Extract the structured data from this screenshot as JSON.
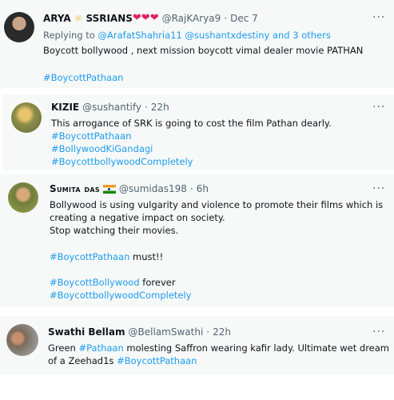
{
  "tweets": [
    {
      "name": "ARYA",
      "name_suffix": "SSRIANS",
      "handle": "@RajKArya9",
      "time": "Dec 7",
      "reply_prefix": "Replying to",
      "reply_to": "@ArafatShahria11 @sushantxdestiny and 3 others",
      "text1": "Boycott bollywood , next mission boycott vimal dealer movie PATHAN",
      "hashtag1": "#BoycottPathaan"
    },
    {
      "name": "KIZIE",
      "handle": "@sushantify",
      "time": "22h",
      "text1": "This arrogance of SRK is going to cost the film Pathan dearly.",
      "hashtag1": "#BoycottPathaan",
      "hashtag2": "#BollywoodKiGandagi",
      "hashtag3": "#BoycottbollywoodCompletely"
    },
    {
      "name": "Sumita das",
      "handle": "@sumidas198",
      "time": "6h",
      "text1": "Bollywood is using vulgarity and violence to promote their films which is",
      "text2": "creating a negative impact on society.",
      "text3": "Stop watching their movies.",
      "hashtag1": "#BoycottPathaan",
      "after1": " must!!",
      "hashtag2": "#BoycottBollywood",
      "after2": " forever",
      "hashtag3": "#BoycottbollywoodCompletely"
    },
    {
      "name": "Swathi Bellam",
      "handle": "@BellamSwathi",
      "time": "22h",
      "text1_pre": "Green ",
      "hashtag1": "#Pathaan",
      "text1_post": " molesting Saffron wearing kafir lady. Ultimate wet dream",
      "text2_pre": "of a Zeehad1s ",
      "hashtag2": "#BoycottPathaan"
    }
  ],
  "dot": "·",
  "more_glyph": "···",
  "colors": {
    "link": "#1d9bf0",
    "muted": "#536471",
    "card_bg": "#f7f9f9"
  }
}
